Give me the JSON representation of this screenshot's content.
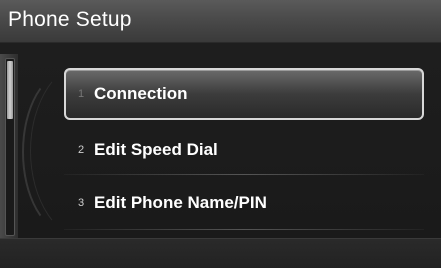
{
  "header": {
    "title": "Phone Setup"
  },
  "menu": {
    "items": [
      {
        "number": "1",
        "label": "Connection",
        "selected": true
      },
      {
        "number": "2",
        "label": "Edit Speed Dial",
        "selected": false
      },
      {
        "number": "3",
        "label": "Edit Phone Name/PIN",
        "selected": false
      }
    ]
  },
  "colors": {
    "title_bar": "#4a4a4a",
    "background": "#000000",
    "selection_border": "#d8d8d8",
    "text": "#ffffff"
  },
  "icons": {
    "scroll": "scrollbar"
  }
}
